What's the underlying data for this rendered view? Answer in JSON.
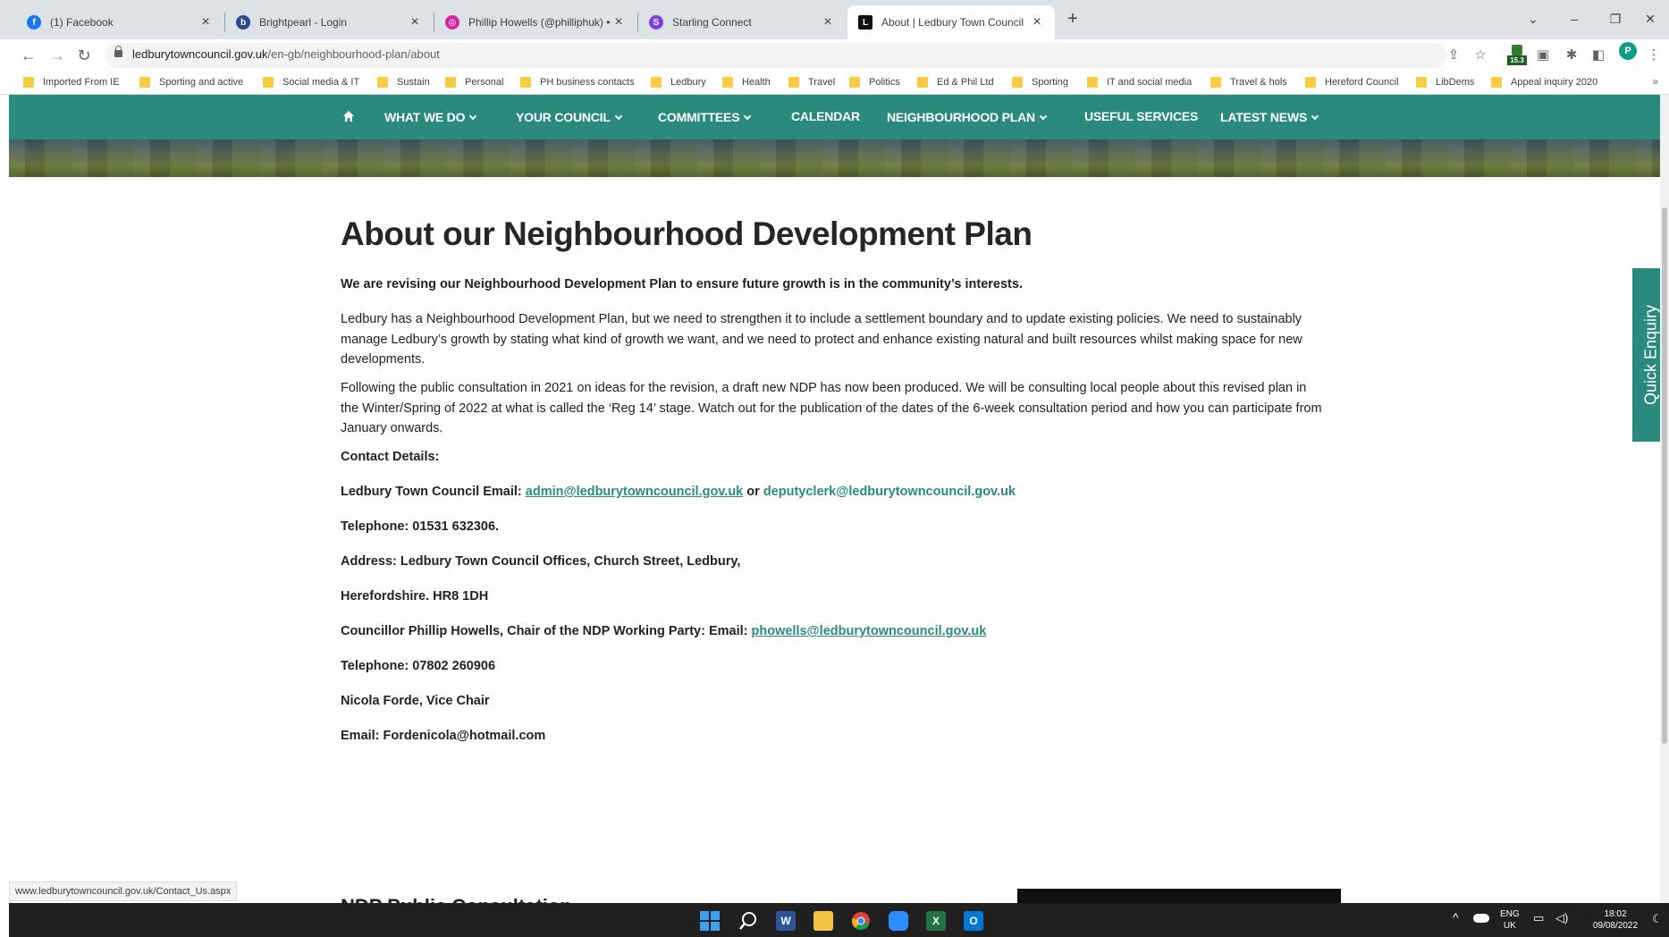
{
  "browser": {
    "tabs": [
      {
        "title": "(1) Facebook",
        "active": false,
        "favicon_color": "#1877f2",
        "favicon_glyph": "f"
      },
      {
        "title": "Brightpearl - Login",
        "active": false,
        "favicon_color": "#2a4b8d",
        "favicon_glyph": "b"
      },
      {
        "title": "Phillip Howells (@philliphuk) • In",
        "active": false,
        "favicon_color": "#d6249f",
        "favicon_glyph": "◎"
      },
      {
        "title": "Starling Connect",
        "active": false,
        "favicon_color": "#7b3fe4",
        "favicon_glyph": "S"
      },
      {
        "title": "About | Ledbury Town Council",
        "active": true,
        "favicon_color": "#111111",
        "favicon_glyph": "L"
      }
    ],
    "address_domain": "ledburytowncouncil.gov.uk",
    "address_path": "/en-gb/neighbourhood-plan/about",
    "extension_badge": "15.3",
    "profile_initial": "P",
    "bookmarks": [
      "Imported From IE",
      "Sporting and active",
      "Social media & IT",
      "Sustain",
      "Personal",
      "PH business contacts",
      "Ledbury",
      "Health",
      "Travel",
      "Politics",
      "Ed & Phil Ltd",
      "Sporting",
      "IT and social media",
      "Travel & hols",
      "Hereford Council",
      "LibDems",
      "Appeal inquiry 2020"
    ],
    "bookmarks_more": "»",
    "status_url": "www.ledburytowncouncil.gov.uk/Contact_Us.aspx"
  },
  "site": {
    "nav": [
      {
        "label": "WHAT WE DO",
        "dropdown": true
      },
      {
        "label": "YOUR COUNCIL",
        "dropdown": true
      },
      {
        "label": "COMMITTEES",
        "dropdown": true
      },
      {
        "label": "CALENDAR",
        "dropdown": false
      },
      {
        "label": "NEIGHBOURHOOD PLAN",
        "dropdown": true
      },
      {
        "label": "USEFUL SERVICES",
        "dropdown": false
      },
      {
        "label": "LATEST NEWS",
        "dropdown": true
      }
    ],
    "accent_color": "#2a8a7e",
    "quick_enquiry": "Quick Enquiry"
  },
  "article": {
    "title": "About our Neighbourhood Development Plan",
    "intro": "We are revising our Neighbourhood Development Plan to ensure future growth is in the community’s interests.",
    "para1": "Ledbury has a Neighbourhood Development Plan, but we need to strengthen it to include a settlement boundary and to update existing policies.  We need to sustainably manage Ledbury’s growth by stating what kind of growth we want, and we need to protect and enhance existing natural and built resources whilst making space for new developments.",
    "para2": "Following the public consultation in 2021 on ideas for the revision, a draft new NDP has now been produced.  We will be consulting local people about this revised plan in the Winter/Spring of 2022 at what is called the ‘Reg 14’ stage.  Watch out for the publication of the dates of the 6-week consultation period and how you can participate from January onwards.",
    "contact_heading": "Contact Details:",
    "email_label": "Ledbury Town Council Email: ",
    "email1": "admin@ledburytowncouncil.gov.uk",
    "or": " or ",
    "email2": "deputyclerk@ledburytowncouncil.gov.uk",
    "telephone1": "Telephone: 01531 632306.",
    "address1": "Address:  Ledbury Town Council Offices, Church Street, Ledbury,",
    "address2": "Herefordshire. HR8 1DH",
    "councillor_label": "Councillor Phillip Howells, Chair of the NDP Working Party: Email: ",
    "councillor_email": "phowells@ledburytowncouncil.gov.uk",
    "telephone2": "Telephone: 07802 260906",
    "vice_chair": "Nicola Forde, Vice Chair",
    "vice_email": "Email: Fordenicola@hotmail.com",
    "next_heading": "NDP Public Consultation"
  },
  "taskbar": {
    "apps": [
      {
        "name": "start",
        "color": "#3aa0f3"
      },
      {
        "name": "search",
        "color": "#ffffff"
      },
      {
        "name": "word",
        "color": "#2b579a"
      },
      {
        "name": "files",
        "color": "#f5c542"
      },
      {
        "name": "chrome",
        "color": "#db4437"
      },
      {
        "name": "zoom",
        "color": "#2d8cff"
      },
      {
        "name": "excel",
        "color": "#217346"
      },
      {
        "name": "outlook",
        "color": "#0078d4"
      }
    ],
    "lang_top": "ENG",
    "lang_bottom": "UK",
    "time": "18:02",
    "date": "09/08/2022"
  }
}
